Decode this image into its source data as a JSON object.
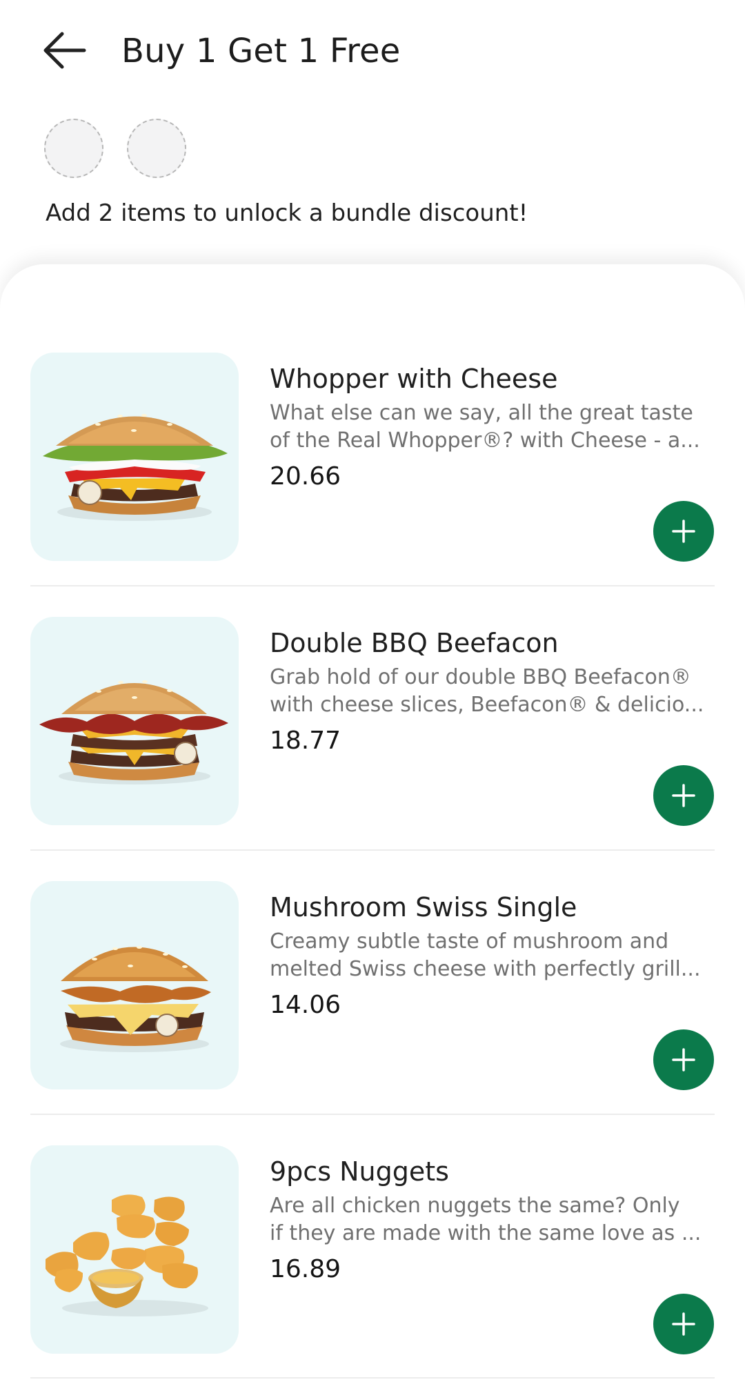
{
  "header": {
    "title": "Buy 1 Get 1 Free"
  },
  "bundle": {
    "message": "Add 2 items to unlock a bundle discount!"
  },
  "products": [
    {
      "name": "Whopper with Cheese",
      "description": [
        "What else can we say, all the great taste",
        "of the Real Whopper®? with Cheese - a..."
      ],
      "price": "20.66"
    },
    {
      "name": "Double BBQ Beefacon",
      "description": [
        "Grab hold of our double BBQ Beefacon®",
        "with cheese slices, Beefacon® & delicio..."
      ],
      "price": "18.77"
    },
    {
      "name": "Mushroom Swiss Single",
      "description": [
        "Creamy subtle taste of mushroom and",
        "melted Swiss cheese with perfectly grill..."
      ],
      "price": "14.06"
    },
    {
      "name": "9pcs Nuggets",
      "description": [
        "Are all chicken nuggets the same? Only",
        "if they are made with the same love as ..."
      ],
      "price": "16.89"
    }
  ],
  "icons": {
    "back": "arrow-left-icon",
    "add": "plus-icon"
  },
  "colors": {
    "accent": "#0b7a4b",
    "image_background": "#e9f7f8",
    "text_primary": "#1f1f1f",
    "text_secondary": "#707070"
  }
}
